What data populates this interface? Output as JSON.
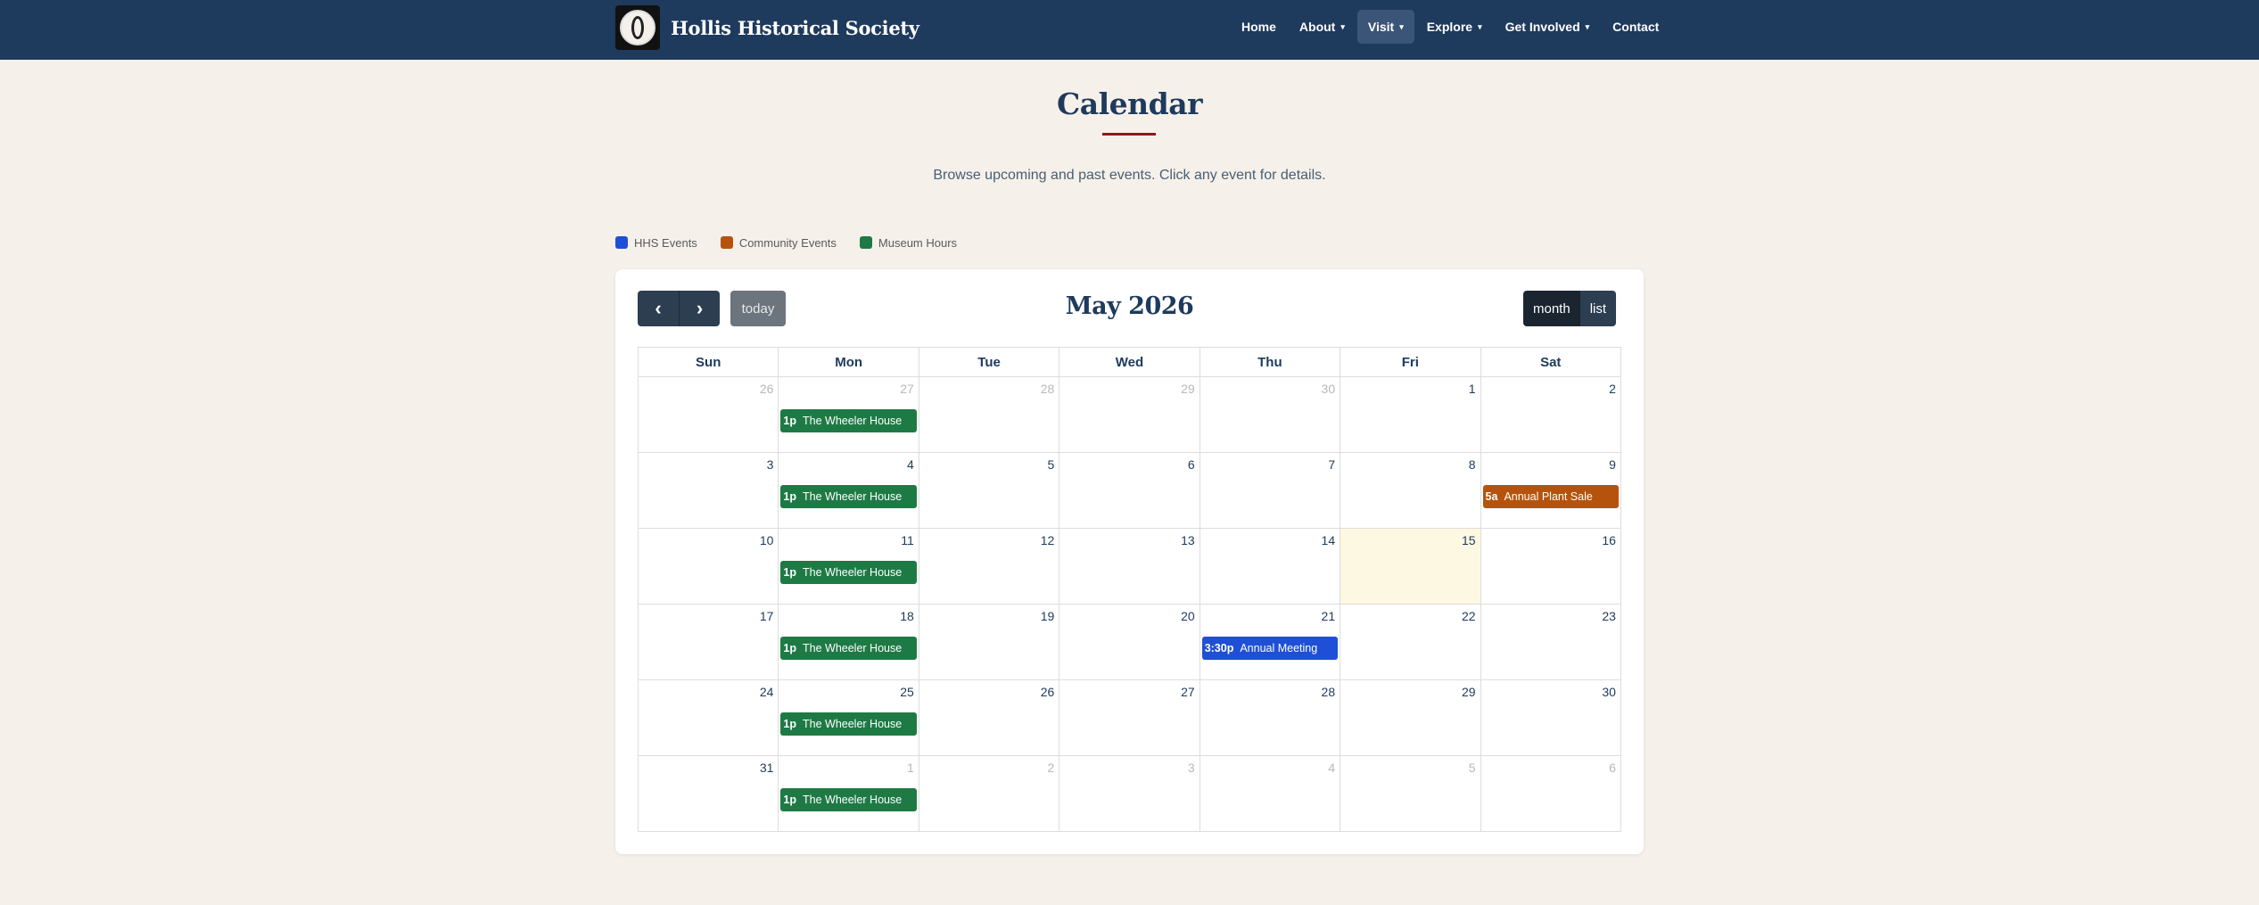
{
  "site": {
    "name": "Hollis Historical Society"
  },
  "nav": {
    "items": [
      {
        "label": "Home",
        "dropdown": false,
        "active": false
      },
      {
        "label": "About",
        "dropdown": true,
        "active": false
      },
      {
        "label": "Visit",
        "dropdown": true,
        "active": true
      },
      {
        "label": "Explore",
        "dropdown": true,
        "active": false
      },
      {
        "label": "Get Involved",
        "dropdown": true,
        "active": false
      },
      {
        "label": "Contact",
        "dropdown": false,
        "active": false
      }
    ]
  },
  "page": {
    "title": "Calendar",
    "subtitle": "Browse upcoming and past events. Click any event for details."
  },
  "legend": [
    {
      "label": "HHS Events",
      "color": "#1f4fd6"
    },
    {
      "label": "Community Events",
      "color": "#b5530c"
    },
    {
      "label": "Museum Hours",
      "color": "#1e7a45"
    }
  ],
  "calendar": {
    "title": "May 2026",
    "today_label": "today",
    "prev_icon": "chevron-left-icon",
    "next_icon": "chevron-right-icon",
    "views": [
      {
        "label": "month",
        "active": true
      },
      {
        "label": "list",
        "active": false
      }
    ],
    "days_of_week": [
      "Sun",
      "Mon",
      "Tue",
      "Wed",
      "Thu",
      "Fri",
      "Sat"
    ],
    "weeks": [
      [
        {
          "day": "26",
          "other": true
        },
        {
          "day": "27",
          "other": true,
          "event": {
            "time": "1p",
            "title": "The Wheeler House",
            "type": "museum"
          }
        },
        {
          "day": "28",
          "other": true
        },
        {
          "day": "29",
          "other": true
        },
        {
          "day": "30",
          "other": true
        },
        {
          "day": "1"
        },
        {
          "day": "2"
        }
      ],
      [
        {
          "day": "3"
        },
        {
          "day": "4",
          "event": {
            "time": "1p",
            "title": "The Wheeler House",
            "type": "museum"
          }
        },
        {
          "day": "5"
        },
        {
          "day": "6"
        },
        {
          "day": "7"
        },
        {
          "day": "8"
        },
        {
          "day": "9",
          "event": {
            "time": "5a",
            "title": "Annual Plant Sale",
            "type": "community"
          }
        }
      ],
      [
        {
          "day": "10"
        },
        {
          "day": "11",
          "event": {
            "time": "1p",
            "title": "The Wheeler House",
            "type": "museum"
          }
        },
        {
          "day": "12"
        },
        {
          "day": "13"
        },
        {
          "day": "14"
        },
        {
          "day": "15",
          "today": true
        },
        {
          "day": "16"
        }
      ],
      [
        {
          "day": "17"
        },
        {
          "day": "18",
          "event": {
            "time": "1p",
            "title": "The Wheeler House",
            "type": "museum"
          }
        },
        {
          "day": "19"
        },
        {
          "day": "20"
        },
        {
          "day": "21",
          "event": {
            "time": "3:30p",
            "title": "Annual Meeting",
            "type": "hhs"
          }
        },
        {
          "day": "22"
        },
        {
          "day": "23"
        }
      ],
      [
        {
          "day": "24"
        },
        {
          "day": "25",
          "event": {
            "time": "1p",
            "title": "The Wheeler House",
            "type": "museum"
          }
        },
        {
          "day": "26"
        },
        {
          "day": "27"
        },
        {
          "day": "28"
        },
        {
          "day": "29"
        },
        {
          "day": "30"
        }
      ],
      [
        {
          "day": "31"
        },
        {
          "day": "1",
          "other": true,
          "event": {
            "time": "1p",
            "title": "The Wheeler House",
            "type": "museum"
          }
        },
        {
          "day": "2",
          "other": true
        },
        {
          "day": "3",
          "other": true
        },
        {
          "day": "4",
          "other": true
        },
        {
          "day": "5",
          "other": true
        },
        {
          "day": "6",
          "other": true
        }
      ]
    ]
  },
  "colors": {
    "navbar": "#1e3a5c",
    "hhs": "#1f4fd6",
    "community": "#b5530c",
    "museum": "#1e7a45",
    "today_bg": "#fdf8e1"
  }
}
